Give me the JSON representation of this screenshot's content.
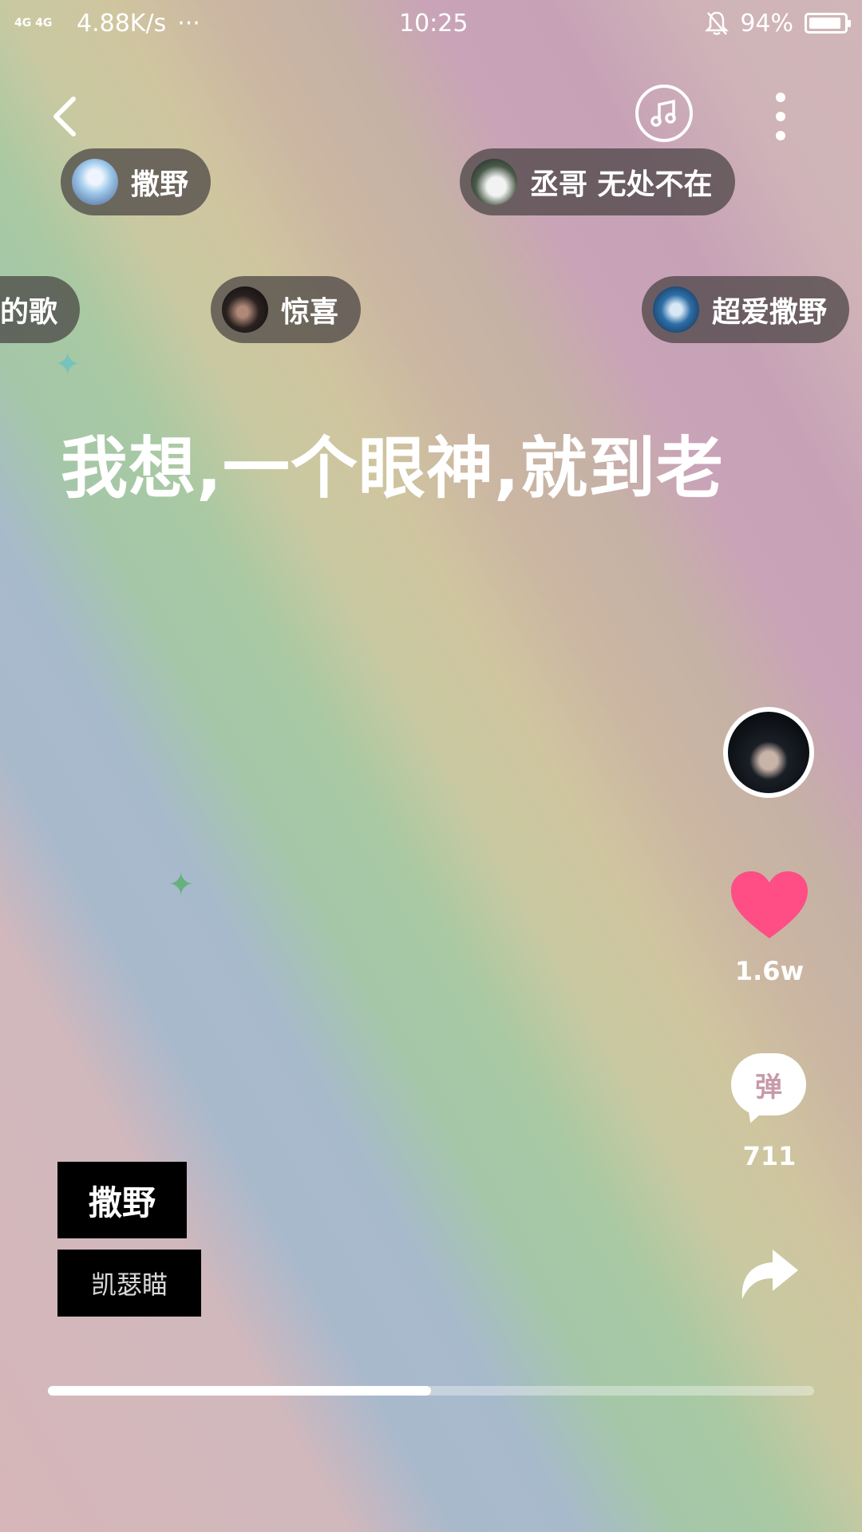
{
  "status_bar": {
    "network": "4G 4G",
    "speed": "4.88K/s",
    "more": "···",
    "time": "10:25",
    "battery": "94%",
    "battery_level": 0.94
  },
  "header": {
    "back_icon": "chevron-left-icon",
    "music_icon": "music-note-icon",
    "more_icon": "more-vertical-icon"
  },
  "bubbles": [
    {
      "text": "撒野"
    },
    {
      "text": "丞哥 无处不在"
    },
    {
      "text": "的歌"
    },
    {
      "text": "惊喜"
    },
    {
      "text": "超爱撒野"
    }
  ],
  "lyric": "我想,一个眼神,就到老",
  "actions": {
    "like_count": "1.6w",
    "danmu_label": "弹",
    "danmu_count": "711",
    "colors": {
      "like": "#ff4d85"
    }
  },
  "song": {
    "title": "撒野",
    "artist": "凯瑟瞄"
  },
  "progress": 0.5
}
